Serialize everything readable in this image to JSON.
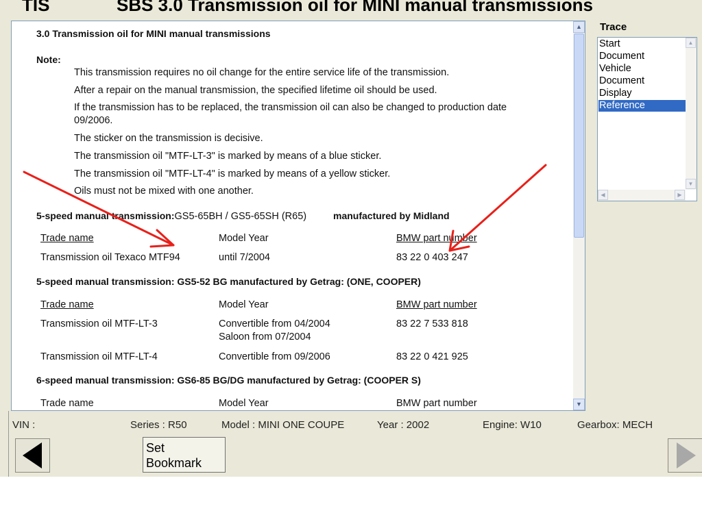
{
  "header": {
    "app_name": "TIS",
    "title": "SBS  3.0 Transmission oil for MINI manual transmissions"
  },
  "document": {
    "heading": "3.0 Transmission oil for MINI manual transmissions",
    "note_label": "Note:",
    "notes": [
      "This transmission requires no oil change for the entire service life of the transmission.",
      "After a repair on the manual transmission, the specified lifetime oil should be used.",
      "If the transmission has to be replaced, the transmission oil can also be changed to production date",
      "09/2006.",
      "The sticker on the transmission is decisive.",
      "The transmission oil \"MTF-LT-3\" is marked by means of a blue sticker.",
      "The transmission oil \"MTF-LT-4\" is marked by means of a yellow sticker.",
      "Oils must not be mixed with one another."
    ],
    "section1": {
      "prefix": "5-speed manual transmission:",
      "model": "GS5-65BH / GS5-65SH (R65)",
      "maker": "manufactured by Midland"
    },
    "columns": {
      "trade_name": "Trade name",
      "model_year": "Model Year",
      "part_number": "BMW part number"
    },
    "table1": [
      {
        "trade_name": "Transmission oil Texaco MTF94",
        "model_year": "until 7/2004",
        "part_number": "83 22 0 403 247"
      }
    ],
    "section2": "5-speed manual transmission: GS5-52 BG manufactured by Getrag: (ONE, COOPER)",
    "table2": [
      {
        "trade_name": "Transmission oil MTF-LT-3",
        "model_year": "Convertible from 04/2004",
        "model_year_2": "Saloon from 07/2004",
        "part_number": "83 22 7 533 818"
      },
      {
        "trade_name": "Transmission oil MTF-LT-4",
        "model_year": "Convertible from 09/2006",
        "part_number": "83 22 0 421 925"
      }
    ],
    "section3": "6-speed manual transmission: GS6-85 BG/DG manufactured by Getrag: (COOPER S)",
    "table3_header": {
      "trade_name": "Trade name",
      "model_year": "Model Year",
      "part_number": "BMW part number"
    }
  },
  "trace": {
    "label": "Trace",
    "items": [
      "Start",
      "Document",
      "Vehicle",
      "Document",
      "Display",
      "Reference"
    ],
    "selected_index": 5
  },
  "status": {
    "vin": "VIN :",
    "series": "Series : R50",
    "model": "Model : MINI ONE COUPE",
    "year": "Year : 2002",
    "engine": "Engine: W10",
    "gearbox": "Gearbox: MECH"
  },
  "nav": {
    "bookmark_label": "Set\nBookmark"
  },
  "colors": {
    "background": "#eae8d8",
    "selection": "#316ac5",
    "annotation": "#e8201a"
  },
  "icons": {
    "back": "back-triangle-icon",
    "forward": "forward-triangle-icon",
    "annotation": "red-arrow-icon"
  }
}
